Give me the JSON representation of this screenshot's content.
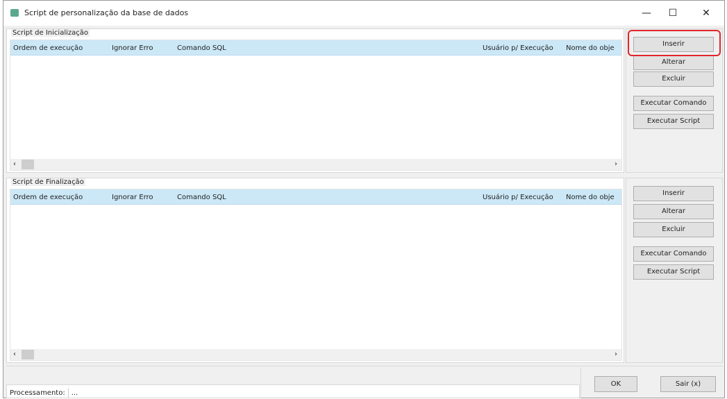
{
  "window": {
    "title": "Script de personalização da base de dados",
    "minimize": "—",
    "maximize": "☐",
    "close": "✕"
  },
  "columns": [
    "Ordem de execução",
    "Ignorar Erro",
    "Comando SQL",
    "Usuário p/ Execução",
    "Nome do obje"
  ],
  "init": {
    "label": "Script de Inicialização",
    "buttons": [
      "Inserir",
      "Alterar",
      "Excluir",
      "Executar Comando",
      "Executar Script"
    ]
  },
  "final": {
    "label": "Script de Finalização",
    "buttons": [
      "Inserir",
      "Alterar",
      "Excluir",
      "Executar Comando",
      "Executar Script"
    ]
  },
  "scroll": {
    "left": "‹",
    "right": "›"
  },
  "footer": {
    "status_label": "Processamento:",
    "status_value": "...",
    "ok": "OK",
    "exit": "Sair (x)"
  }
}
